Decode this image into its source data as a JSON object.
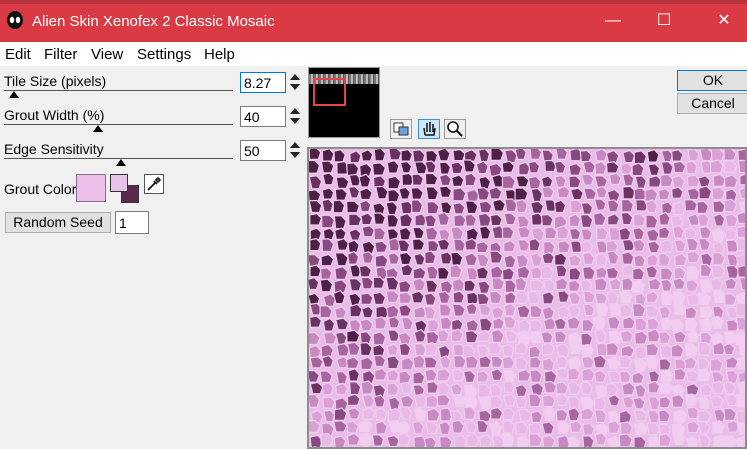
{
  "window": {
    "title": "Alien Skin Xenofex 2 Classic Mosaic",
    "controls": {
      "minimize": "—",
      "maximize": "☐",
      "close": "✕"
    }
  },
  "menu": [
    "Edit",
    "Filter",
    "View",
    "Settings",
    "Help"
  ],
  "params": {
    "tile_size": {
      "label": "Tile Size (pixels)",
      "value": "8.27"
    },
    "grout_width": {
      "label": "Grout Width (%)",
      "value": "40"
    },
    "edge_sensitivity": {
      "label": "Edge Sensitivity",
      "value": "50"
    }
  },
  "grout_color": {
    "label": "Grout Color",
    "color": "#ecbfea"
  },
  "seed": {
    "button": "Random Seed",
    "value": "1"
  },
  "buttons": {
    "ok": "OK",
    "cancel": "Cancel"
  },
  "colors": {
    "titlebar": "#d93a43",
    "preview_base": "#e9bde8",
    "tile_dark": "#5a2a4c"
  },
  "tools": [
    "preview-compare-icon",
    "hand-icon",
    "zoom-icon"
  ]
}
